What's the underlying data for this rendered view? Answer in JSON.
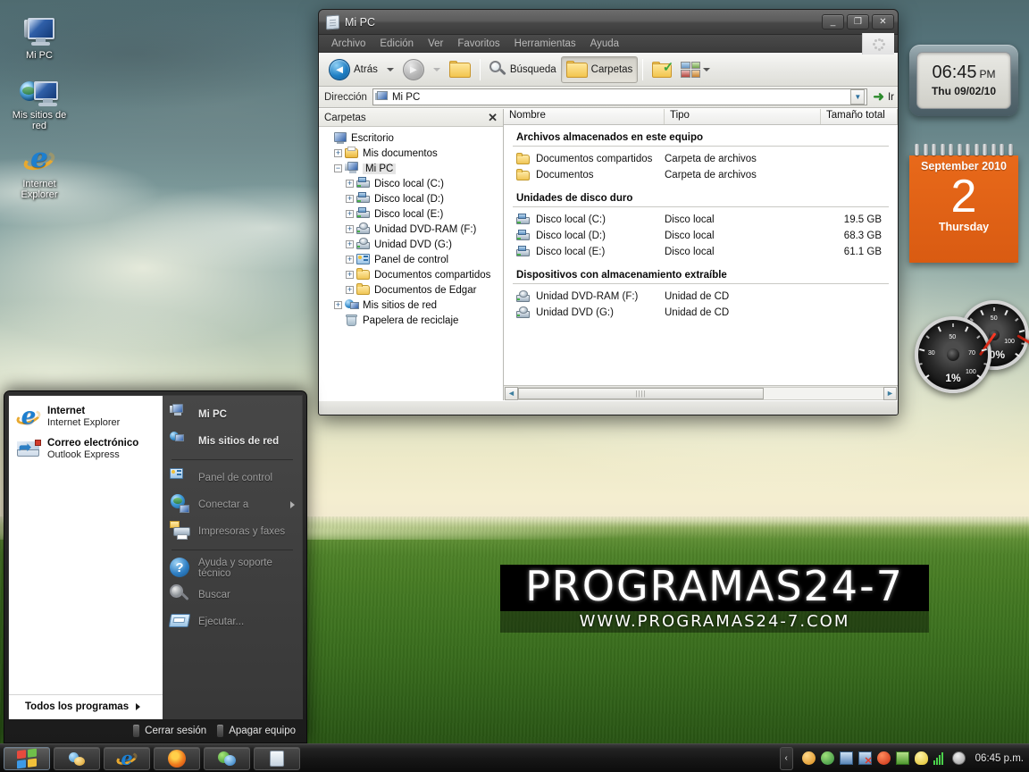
{
  "desktop": {
    "icons": [
      {
        "label": "Mi PC",
        "icon": "computer-icon"
      },
      {
        "label": "Mis sitios de red",
        "icon": "network-icon"
      },
      {
        "label": "Internet Explorer",
        "icon": "internet-explorer-icon"
      }
    ],
    "watermark": {
      "main": "PROGRAMAS24-7",
      "sub": "WWW.PROGRAMAS24-7.COM"
    }
  },
  "window": {
    "title": "Mi PC",
    "buttons": {
      "minimize": "_",
      "maximize": "❐",
      "close": "✕"
    },
    "menu": [
      "Archivo",
      "Edición",
      "Ver",
      "Favoritos",
      "Herramientas",
      "Ayuda"
    ],
    "toolbar": {
      "back": "Atrás",
      "search": "Búsqueda",
      "folders": "Carpetas"
    },
    "address": {
      "label": "Dirección",
      "value": "Mi PC",
      "go": "Ir"
    },
    "tree": {
      "header": "Carpetas",
      "close": "✕",
      "nodes": [
        {
          "label": "Escritorio",
          "indent": 0,
          "expander": "",
          "icon": "monitor-icon",
          "selected": false
        },
        {
          "label": "Mis documentos",
          "indent": 1,
          "expander": "+",
          "icon": "docs-folder-icon",
          "selected": false
        },
        {
          "label": "Mi PC",
          "indent": 1,
          "expander": "−",
          "icon": "computer-icon",
          "selected": true
        },
        {
          "label": "Disco local (C:)",
          "indent": 2,
          "expander": "+",
          "icon": "drive-icon",
          "selected": false
        },
        {
          "label": "Disco local (D:)",
          "indent": 2,
          "expander": "+",
          "icon": "drive-icon",
          "selected": false
        },
        {
          "label": "Disco local (E:)",
          "indent": 2,
          "expander": "+",
          "icon": "drive-icon",
          "selected": false
        },
        {
          "label": "Unidad DVD-RAM (F:)",
          "indent": 2,
          "expander": "+",
          "icon": "cd-drive-icon",
          "selected": false
        },
        {
          "label": "Unidad DVD (G:)",
          "indent": 2,
          "expander": "+",
          "icon": "cd-drive-icon",
          "selected": false
        },
        {
          "label": "Panel de control",
          "indent": 2,
          "expander": "+",
          "icon": "control-panel-icon",
          "selected": false
        },
        {
          "label": "Documentos compartidos",
          "indent": 2,
          "expander": "+",
          "icon": "folder-icon",
          "selected": false
        },
        {
          "label": "Documentos de Edgar",
          "indent": 2,
          "expander": "+",
          "icon": "folder-icon",
          "selected": false
        },
        {
          "label": "Mis sitios de red",
          "indent": 1,
          "expander": "+",
          "icon": "network-icon",
          "selected": false
        },
        {
          "label": "Papelera de reciclaje",
          "indent": 1,
          "expander": "",
          "icon": "recycle-bin-icon",
          "selected": false
        }
      ]
    },
    "list": {
      "columns": [
        "Nombre",
        "Tipo",
        "Tamaño total"
      ],
      "groups": [
        {
          "title": "Archivos almacenados en este equipo",
          "rows": [
            {
              "name": "Documentos compartidos",
              "type": "Carpeta de archivos",
              "size": "",
              "icon": "folder-icon",
              "redacted": false
            },
            {
              "name": "Documentos",
              "type": "Carpeta de archivos",
              "size": "",
              "icon": "folder-icon",
              "redacted": true
            }
          ]
        },
        {
          "title": "Unidades de disco duro",
          "rows": [
            {
              "name": "Disco local (C:)",
              "type": "Disco local",
              "size": "19.5 GB",
              "icon": "drive-icon",
              "redacted": false
            },
            {
              "name": "Disco local (D:)",
              "type": "Disco local",
              "size": "68.3 GB",
              "icon": "drive-icon",
              "redacted": false
            },
            {
              "name": "Disco local (E:)",
              "type": "Disco local",
              "size": "61.1 GB",
              "icon": "drive-icon",
              "redacted": false
            }
          ]
        },
        {
          "title": "Dispositivos con almacenamiento extraíble",
          "rows": [
            {
              "name": "Unidad DVD-RAM (F:)",
              "type": "Unidad de CD",
              "size": "",
              "icon": "cd-drive-icon",
              "redacted": false
            },
            {
              "name": "Unidad DVD (G:)",
              "type": "Unidad de CD",
              "size": "",
              "icon": "cd-drive-icon",
              "redacted": false
            }
          ]
        }
      ]
    }
  },
  "gadgets": {
    "clock": {
      "time": "06:45",
      "ampm": "PM",
      "date": "Thu 09/02/10"
    },
    "calendar": {
      "month": "September 2010",
      "day": "2",
      "weekday": "Thursday",
      "color": "#e8691a"
    },
    "gauges": [
      {
        "name": "cpu-gauge",
        "value": "1%",
        "numbers": [
          "30",
          "50",
          "70",
          "100"
        ]
      },
      {
        "name": "memory-gauge",
        "value": "20%",
        "numbers": [
          "50",
          "100"
        ]
      }
    ]
  },
  "startmenu": {
    "left": [
      {
        "title": "Internet",
        "subtitle": "Internet Explorer",
        "icon": "internet-explorer-icon"
      },
      {
        "title": "Correo electrónico",
        "subtitle": "Outlook Express",
        "icon": "mail-icon"
      }
    ],
    "right": [
      {
        "label": "Mi PC",
        "icon": "computer-icon",
        "bold": true,
        "arrow": false
      },
      {
        "label": "Mis sitios de red",
        "icon": "network-icon",
        "bold": true,
        "arrow": false
      },
      {
        "separator": true
      },
      {
        "label": "Panel de control",
        "icon": "control-panel-icon",
        "bold": false,
        "arrow": false
      },
      {
        "label": "Conectar a",
        "icon": "connect-icon",
        "bold": false,
        "arrow": true
      },
      {
        "label": "Impresoras y faxes",
        "icon": "printer-icon",
        "bold": false,
        "arrow": false
      },
      {
        "separator": true
      },
      {
        "label": "Ayuda y soporte técnico",
        "icon": "help-icon",
        "bold": false,
        "arrow": false
      },
      {
        "label": "Buscar",
        "icon": "search-icon",
        "bold": false,
        "arrow": false
      },
      {
        "label": "Ejecutar...",
        "icon": "run-icon",
        "bold": false,
        "arrow": false
      }
    ],
    "all_programs": "Todos los programas",
    "logoff": "Cerrar sesión",
    "shutdown": "Apagar equipo"
  },
  "taskbar": {
    "quicklaunch": [
      {
        "name": "start-button",
        "icon": "windows-flag-icon"
      },
      {
        "name": "messenger-button",
        "icon": "messenger-icon"
      },
      {
        "name": "internet-explorer-button",
        "icon": "internet-explorer-icon"
      },
      {
        "name": "firefox-button",
        "icon": "firefox-icon"
      },
      {
        "name": "download-manager-button",
        "icon": "download-icon"
      },
      {
        "name": "my-computer-button",
        "icon": "computer-icon"
      }
    ],
    "tray_chevron": "‹",
    "tray_icons": [
      "mega-icon",
      "messenger-icon",
      "network-activity-icon",
      "network-disconnected-icon",
      "update-icon",
      "app-icon",
      "lightbulb-icon",
      "signal-icon",
      "antivirus-icon"
    ],
    "clock": "06:45 p.m."
  }
}
